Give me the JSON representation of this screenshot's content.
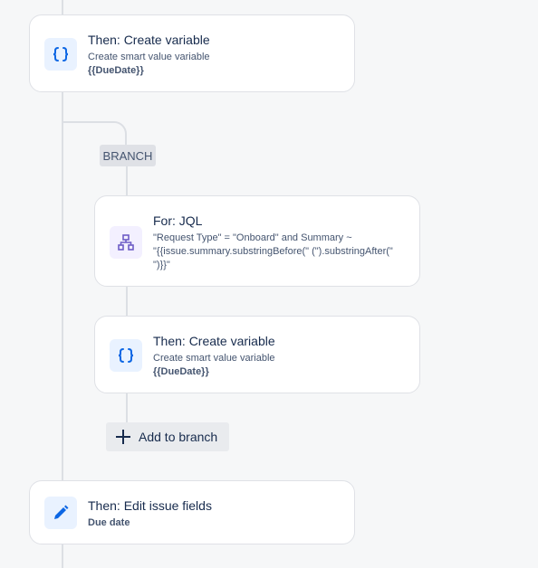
{
  "colors": {
    "accent": "#0c66e4",
    "purple": "#6e5dc6",
    "connector": "#dcdfe4"
  },
  "steps": {
    "create_var_1": {
      "icon": "braces-icon",
      "title": "Then: Create variable",
      "desc": "Create smart value variable",
      "value": "{{DueDate}}"
    },
    "branch": {
      "label": "BRANCH"
    },
    "for_jql": {
      "icon": "hierarchy-icon",
      "title": "For: JQL",
      "line1": "\"Request Type\" = \"Onboard\" and Summary ~",
      "line2": "\"{{issue.summary.substringBefore(\" (\").substringAfter(\"",
      "line3": "\")}}\""
    },
    "create_var_2": {
      "icon": "braces-icon",
      "title": "Then: Create variable",
      "desc": "Create smart value variable",
      "value": "{{DueDate}}"
    },
    "add_to_branch": {
      "icon": "plus-icon",
      "label": "Add to branch"
    },
    "edit_fields": {
      "icon": "pencil-icon",
      "title": "Then: Edit issue fields",
      "value": "Due date"
    }
  }
}
